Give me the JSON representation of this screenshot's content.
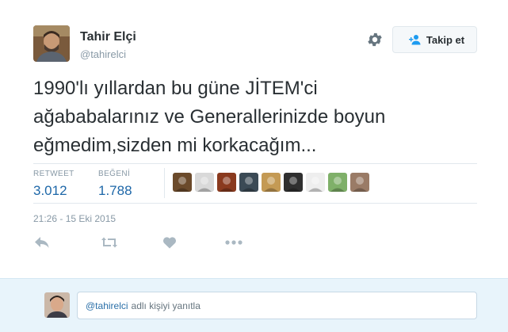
{
  "author": {
    "name": "Tahir Elçi",
    "handle": "@tahirelci"
  },
  "follow_label": "Takip et",
  "tweet_lines": [
    "1990'lı yıllardan bu güne JİTEM'ci",
    "ağababalarınız ve Generallerinizde boyun",
    "eğmedim,sizden mi korkacağım..."
  ],
  "stats": {
    "retweet_label": "RETWEET",
    "retweet_count": "3.012",
    "like_label": "BEĞENİ",
    "like_count": "1.788"
  },
  "liker_colors": [
    "#6b4a2b",
    "#d9d9d9",
    "#8a3a1e",
    "#3b4a55",
    "#c49a54",
    "#2f2f2f",
    "#eeeeee",
    "#7fb069",
    "#9a7b66"
  ],
  "timestamp": "21:26 - 15 Eki 2015",
  "actions": [
    "reply-icon",
    "retweet-icon",
    "like-icon",
    "more-icon"
  ],
  "reply": {
    "mention": "@tahirelci",
    "placeholder": "adlı kişiyi yanıtla"
  },
  "colors": {
    "link_blue": "#1d67a8",
    "muted": "#8899a6",
    "reply_bg": "#e8f4fb"
  }
}
